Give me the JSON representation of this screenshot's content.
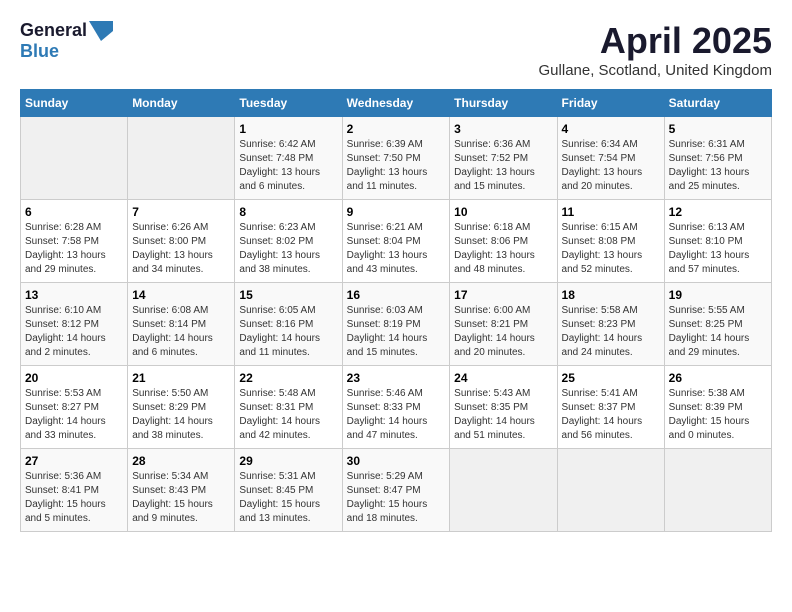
{
  "header": {
    "logo_general": "General",
    "logo_blue": "Blue",
    "month_title": "April 2025",
    "subtitle": "Gullane, Scotland, United Kingdom"
  },
  "days_of_week": [
    "Sunday",
    "Monday",
    "Tuesday",
    "Wednesday",
    "Thursday",
    "Friday",
    "Saturday"
  ],
  "weeks": [
    [
      {
        "day": "",
        "info": ""
      },
      {
        "day": "",
        "info": ""
      },
      {
        "day": "1",
        "info": "Sunrise: 6:42 AM\nSunset: 7:48 PM\nDaylight: 13 hours and 6 minutes."
      },
      {
        "day": "2",
        "info": "Sunrise: 6:39 AM\nSunset: 7:50 PM\nDaylight: 13 hours and 11 minutes."
      },
      {
        "day": "3",
        "info": "Sunrise: 6:36 AM\nSunset: 7:52 PM\nDaylight: 13 hours and 15 minutes."
      },
      {
        "day": "4",
        "info": "Sunrise: 6:34 AM\nSunset: 7:54 PM\nDaylight: 13 hours and 20 minutes."
      },
      {
        "day": "5",
        "info": "Sunrise: 6:31 AM\nSunset: 7:56 PM\nDaylight: 13 hours and 25 minutes."
      }
    ],
    [
      {
        "day": "6",
        "info": "Sunrise: 6:28 AM\nSunset: 7:58 PM\nDaylight: 13 hours and 29 minutes."
      },
      {
        "day": "7",
        "info": "Sunrise: 6:26 AM\nSunset: 8:00 PM\nDaylight: 13 hours and 34 minutes."
      },
      {
        "day": "8",
        "info": "Sunrise: 6:23 AM\nSunset: 8:02 PM\nDaylight: 13 hours and 38 minutes."
      },
      {
        "day": "9",
        "info": "Sunrise: 6:21 AM\nSunset: 8:04 PM\nDaylight: 13 hours and 43 minutes."
      },
      {
        "day": "10",
        "info": "Sunrise: 6:18 AM\nSunset: 8:06 PM\nDaylight: 13 hours and 48 minutes."
      },
      {
        "day": "11",
        "info": "Sunrise: 6:15 AM\nSunset: 8:08 PM\nDaylight: 13 hours and 52 minutes."
      },
      {
        "day": "12",
        "info": "Sunrise: 6:13 AM\nSunset: 8:10 PM\nDaylight: 13 hours and 57 minutes."
      }
    ],
    [
      {
        "day": "13",
        "info": "Sunrise: 6:10 AM\nSunset: 8:12 PM\nDaylight: 14 hours and 2 minutes."
      },
      {
        "day": "14",
        "info": "Sunrise: 6:08 AM\nSunset: 8:14 PM\nDaylight: 14 hours and 6 minutes."
      },
      {
        "day": "15",
        "info": "Sunrise: 6:05 AM\nSunset: 8:16 PM\nDaylight: 14 hours and 11 minutes."
      },
      {
        "day": "16",
        "info": "Sunrise: 6:03 AM\nSunset: 8:19 PM\nDaylight: 14 hours and 15 minutes."
      },
      {
        "day": "17",
        "info": "Sunrise: 6:00 AM\nSunset: 8:21 PM\nDaylight: 14 hours and 20 minutes."
      },
      {
        "day": "18",
        "info": "Sunrise: 5:58 AM\nSunset: 8:23 PM\nDaylight: 14 hours and 24 minutes."
      },
      {
        "day": "19",
        "info": "Sunrise: 5:55 AM\nSunset: 8:25 PM\nDaylight: 14 hours and 29 minutes."
      }
    ],
    [
      {
        "day": "20",
        "info": "Sunrise: 5:53 AM\nSunset: 8:27 PM\nDaylight: 14 hours and 33 minutes."
      },
      {
        "day": "21",
        "info": "Sunrise: 5:50 AM\nSunset: 8:29 PM\nDaylight: 14 hours and 38 minutes."
      },
      {
        "day": "22",
        "info": "Sunrise: 5:48 AM\nSunset: 8:31 PM\nDaylight: 14 hours and 42 minutes."
      },
      {
        "day": "23",
        "info": "Sunrise: 5:46 AM\nSunset: 8:33 PM\nDaylight: 14 hours and 47 minutes."
      },
      {
        "day": "24",
        "info": "Sunrise: 5:43 AM\nSunset: 8:35 PM\nDaylight: 14 hours and 51 minutes."
      },
      {
        "day": "25",
        "info": "Sunrise: 5:41 AM\nSunset: 8:37 PM\nDaylight: 14 hours and 56 minutes."
      },
      {
        "day": "26",
        "info": "Sunrise: 5:38 AM\nSunset: 8:39 PM\nDaylight: 15 hours and 0 minutes."
      }
    ],
    [
      {
        "day": "27",
        "info": "Sunrise: 5:36 AM\nSunset: 8:41 PM\nDaylight: 15 hours and 5 minutes."
      },
      {
        "day": "28",
        "info": "Sunrise: 5:34 AM\nSunset: 8:43 PM\nDaylight: 15 hours and 9 minutes."
      },
      {
        "day": "29",
        "info": "Sunrise: 5:31 AM\nSunset: 8:45 PM\nDaylight: 15 hours and 13 minutes."
      },
      {
        "day": "30",
        "info": "Sunrise: 5:29 AM\nSunset: 8:47 PM\nDaylight: 15 hours and 18 minutes."
      },
      {
        "day": "",
        "info": ""
      },
      {
        "day": "",
        "info": ""
      },
      {
        "day": "",
        "info": ""
      }
    ]
  ]
}
